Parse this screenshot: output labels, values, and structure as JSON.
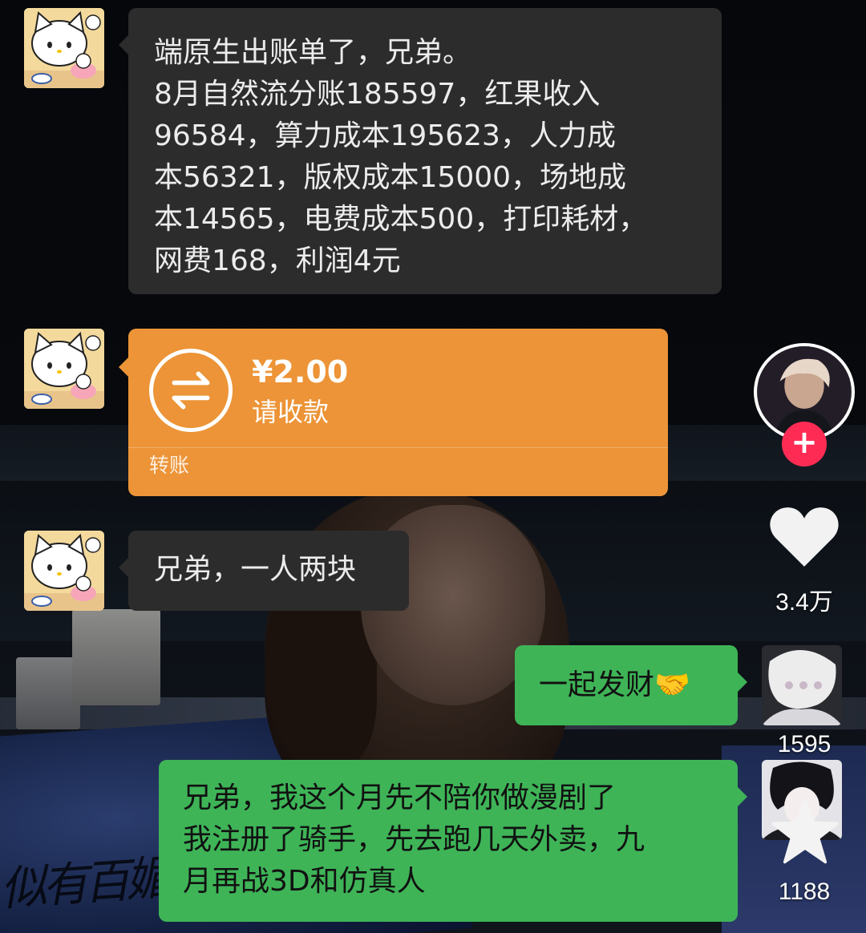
{
  "chat": {
    "messages": [
      {
        "sender": "friend",
        "lines": [
          "端原生出账单了，兄弟。",
          "8月自然流分账185597，红果收入",
          "96584，算力成本195623，人力成",
          "本56321，版权成本15000，场地成",
          "本14565，电费成本500，打印耗材，",
          "网费168，利润4元"
        ]
      },
      {
        "sender": "friend",
        "transfer": {
          "amount": "¥2.00",
          "status": "请收款",
          "kind": "转账"
        }
      },
      {
        "sender": "friend",
        "text": "兄弟，一人两块"
      },
      {
        "sender": "me",
        "text": "一起发财🤝"
      },
      {
        "sender": "me",
        "lines": [
          "兄弟，我这个月先不陪你做漫剧了",
          "我注册了骑手，先去跑几天外卖，九",
          "月再战3D和仿真人"
        ]
      }
    ]
  },
  "video_sidebar": {
    "follow_icon": "plus-icon",
    "like_icon": "heart-icon",
    "like_count": "3.4万",
    "comment_count": "1595",
    "favorite_icon": "star-icon",
    "favorite_count": "1188"
  },
  "watermark": "似有百媚",
  "colors": {
    "incoming_bubble": "#2c2c2c",
    "outgoing_bubble": "#3eb457",
    "transfer_card": "#ec9437",
    "follow_button": "#fe2c55"
  }
}
